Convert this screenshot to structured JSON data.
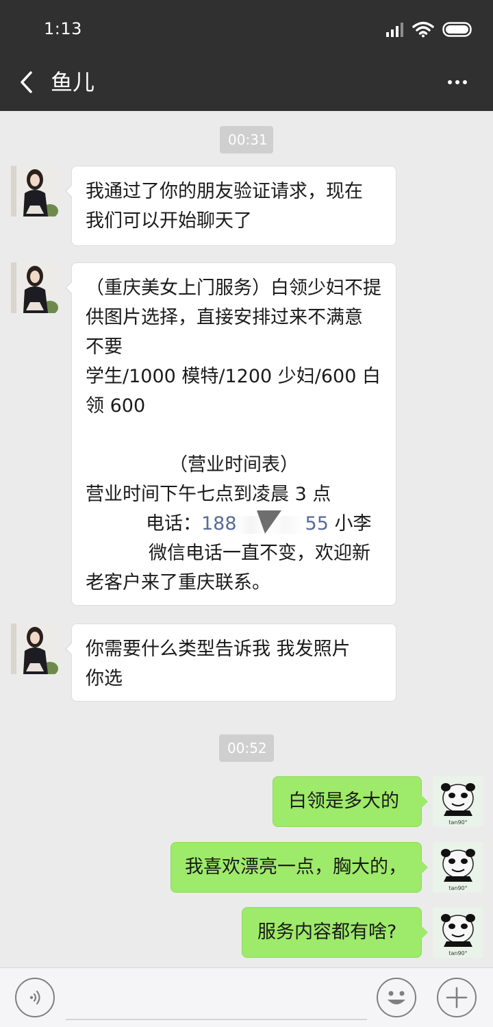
{
  "status_bar": {
    "time": "1:13"
  },
  "header": {
    "title": "鱼儿"
  },
  "messages": {
    "time1": "00:31",
    "m1": {
      "line1": "我通过了你的朋友验证请求，现在",
      "line2": "我们可以开始聊天了"
    },
    "m2": {
      "line1": "（重庆美女上门服务）白领少妇不提",
      "line2": "供图片选择，直接安排过来不满意",
      "line3": "不要",
      "line4": "学生/1000 模特/1200 少妇/600 白",
      "line5": "领 600",
      "line6": "（营业时间表）",
      "line7": "营业时间下午七点到凌晨 3 点",
      "phone_label": "电话：",
      "phone_start": "188",
      "phone_end": "55",
      "phone_name": " 小李",
      "line9": "微信电话一直不变，欢迎新",
      "line10": "老客户来了重庆联系。"
    },
    "m3": {
      "line1": "你需要什么类型告诉我  我发照片",
      "line2": "你选"
    },
    "time2": "00:52",
    "m4": "白领是多大的",
    "m5": "我喜欢漂亮一点，胸大的，",
    "m6": "服务内容都有啥?"
  },
  "sticker_caption": "tan90°",
  "colors": {
    "bar": "#303030",
    "background": "#ebebeb",
    "sent_bubble": "#9eea6a",
    "received_bubble": "#ffffff",
    "link": "#576b95"
  }
}
